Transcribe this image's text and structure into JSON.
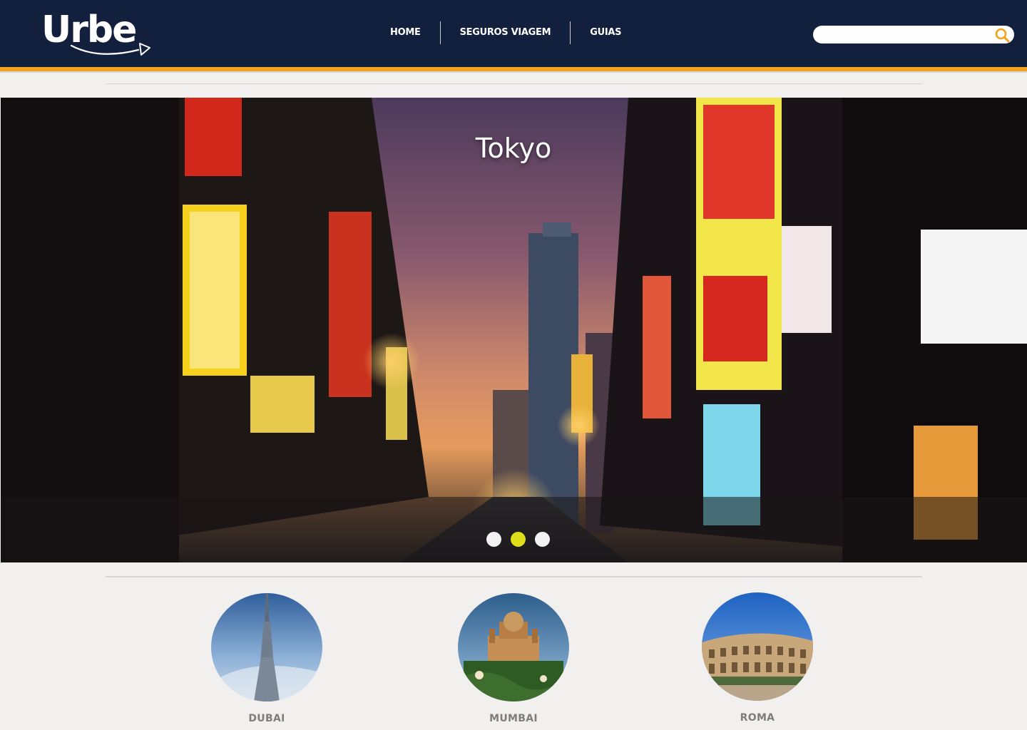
{
  "brand": {
    "name": "Urbe"
  },
  "nav": {
    "items": [
      {
        "label": "HOME"
      },
      {
        "label": "SEGUROS VIAGEM"
      },
      {
        "label": "GUIAS"
      }
    ]
  },
  "search": {
    "placeholder": "",
    "value": "",
    "icon": "search-icon"
  },
  "hero": {
    "title": "Tokyo",
    "slides": {
      "count": 3,
      "active_index": 1
    }
  },
  "destinations": [
    {
      "label": "DUBAI"
    },
    {
      "label": "MUMBAI"
    },
    {
      "label": "ROMA"
    }
  ],
  "colors": {
    "header_bg": "#13203d",
    "accent_orange": "#f3a21c",
    "active_dot": "#dede1a",
    "page_bg": "#f1f0ef",
    "destination_label": "#7d7d7d"
  }
}
